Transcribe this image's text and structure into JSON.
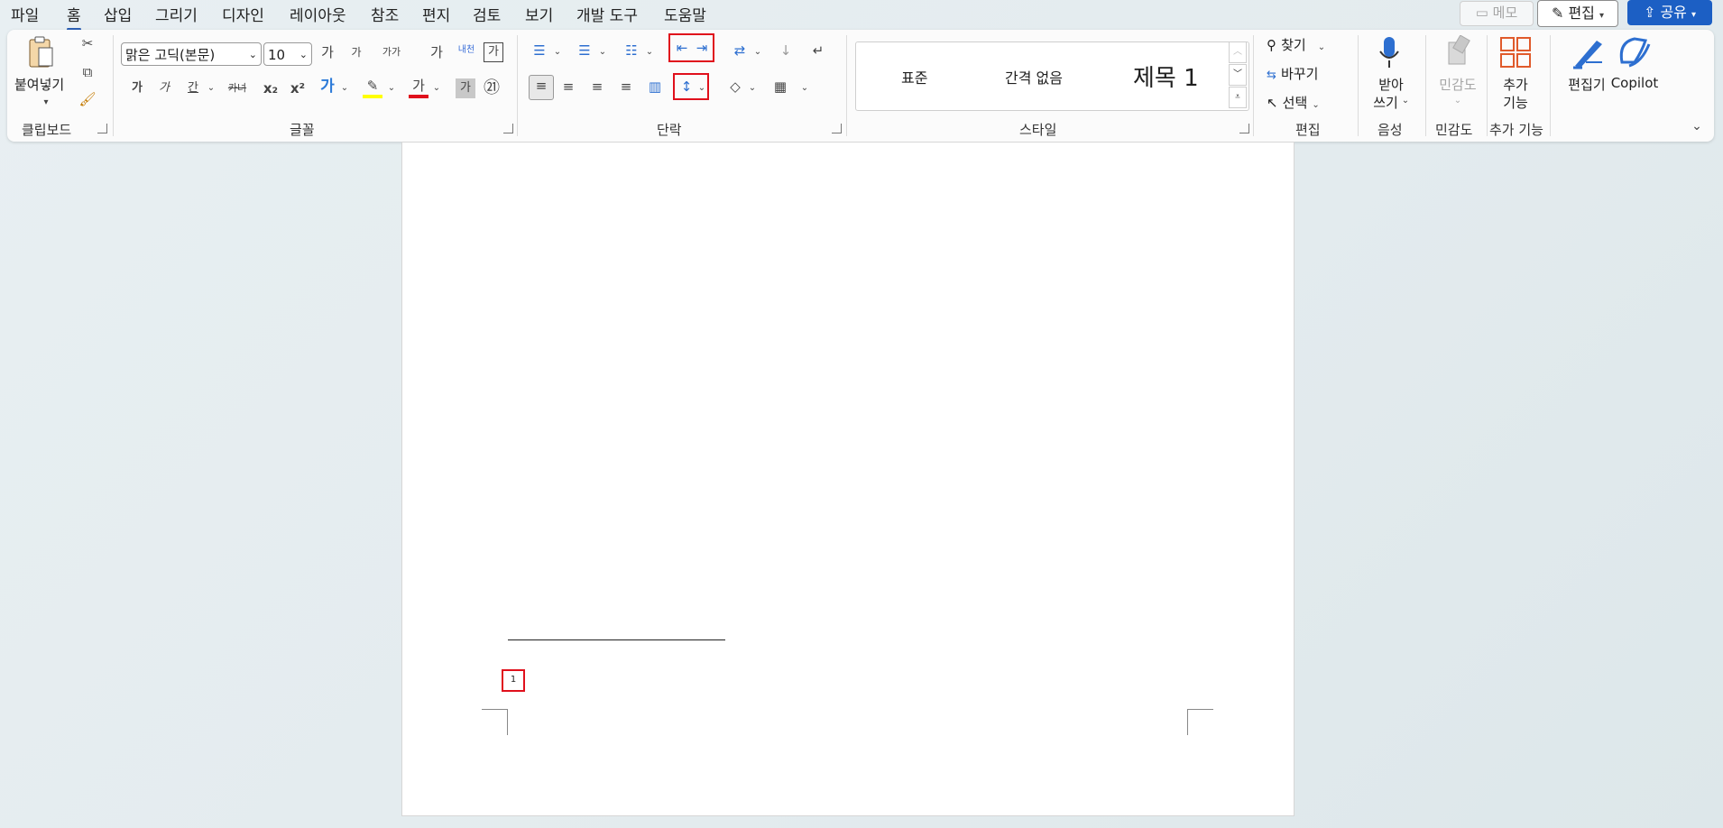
{
  "menu": {
    "items": [
      "파일",
      "홈",
      "삽입",
      "그리기",
      "디자인",
      "레이아웃",
      "참조",
      "편지",
      "검토",
      "보기",
      "개발 도구",
      "도움말"
    ],
    "active": "홈",
    "memo_label": "메모",
    "edit_mode_label": "편집",
    "share_label": "공유"
  },
  "ribbon": {
    "clipboard": {
      "paste_label": "붙여넣기",
      "group_label": "클립보드"
    },
    "font": {
      "font_name": "맑은 고딕(본문)",
      "font_size": "10",
      "grow_glyph": "가",
      "shrink_glyph": "가",
      "case_glyph": "가가",
      "clear_glyph": "가",
      "phonetic_glyph": "내천",
      "border_char_glyph": "가",
      "bold_glyph": "가",
      "italic_glyph": "가",
      "underline_glyph": "간",
      "strike_glyph": "카녀",
      "sub_glyph": "x₂",
      "sup_glyph": "x²",
      "effects_glyph": "가",
      "highlight_glyph": "✎",
      "color_glyph": "가",
      "shade_glyph": "가",
      "enclose_glyph": "㉑",
      "group_label": "글꼴"
    },
    "paragraph": {
      "group_label": "단락"
    },
    "styles": {
      "items": [
        "표준",
        "간격 없음",
        "제목 1"
      ],
      "group_label": "스타일"
    },
    "editing": {
      "find_label": "찾기",
      "replace_label": "바꾸기",
      "select_label": "선택",
      "group_label": "편집"
    },
    "voice": {
      "dictate_label_1": "받아",
      "dictate_label_2": "쓰기",
      "group_label": "음성"
    },
    "sensitivity": {
      "label": "민감도",
      "group_label": "민감도"
    },
    "addins": {
      "label_1": "추가",
      "label_2": "기능",
      "group_label": "추가 기능"
    },
    "editor_label": "편집기",
    "copilot_label": "Copilot"
  },
  "document": {
    "footnote_number": "1"
  },
  "colors": {
    "accent": "#1c5fc4",
    "highlight_box": "#e0101c",
    "highlight_yellow": "#ffff00",
    "font_color_red": "#e0101c"
  }
}
